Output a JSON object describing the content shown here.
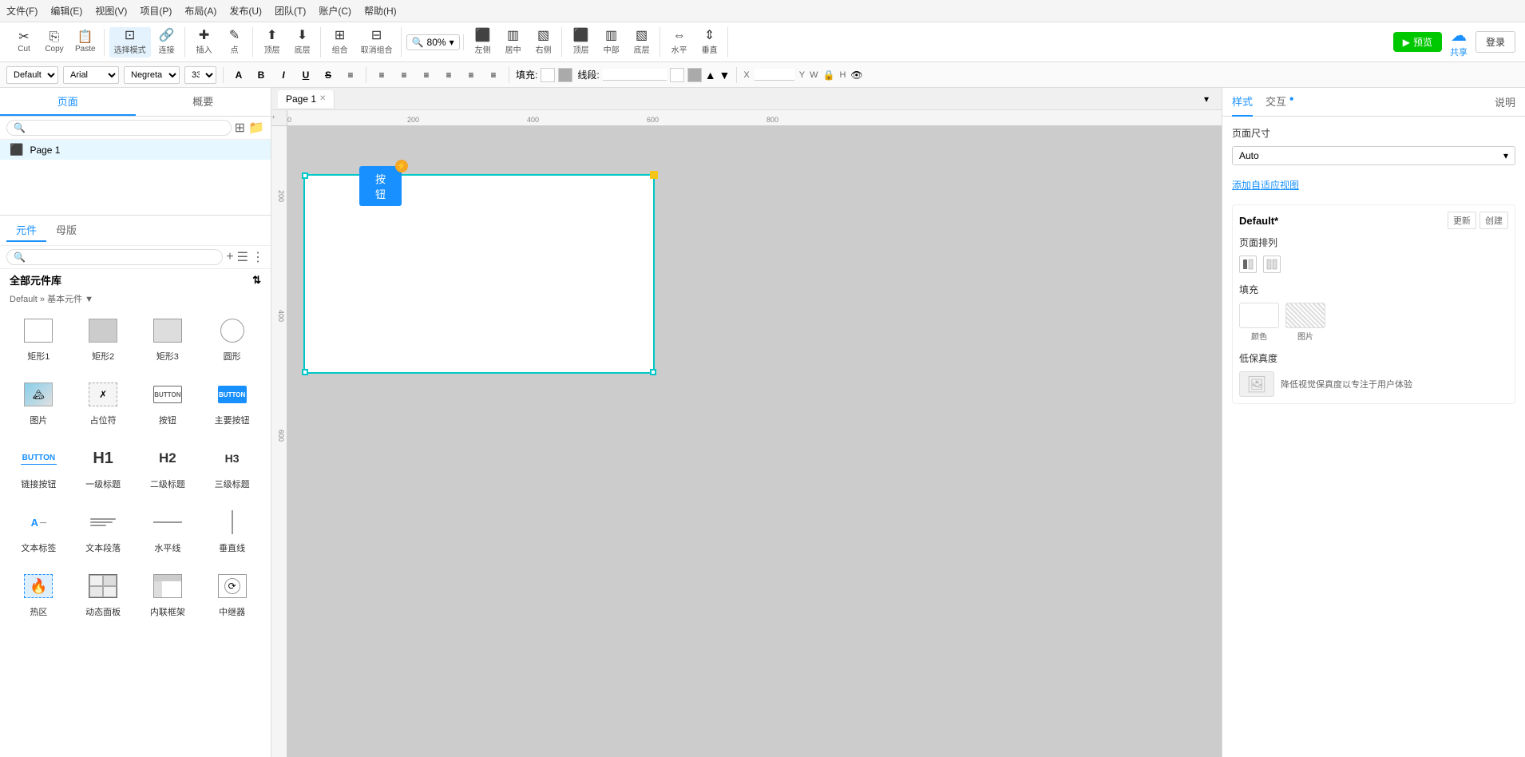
{
  "menubar": {
    "items": [
      {
        "label": "文件(F)"
      },
      {
        "label": "编辑(E)"
      },
      {
        "label": "视图(V)"
      },
      {
        "label": "项目(P)"
      },
      {
        "label": "布局(A)"
      },
      {
        "label": "发布(U)"
      },
      {
        "label": "团队(T)"
      },
      {
        "label": "账户(C)"
      },
      {
        "label": "帮助(H)"
      }
    ]
  },
  "toolbar": {
    "cut_label": "Cut",
    "copy_label": "Copy",
    "paste_label": "Paste",
    "select_mode_label": "选择模式",
    "connect_label": "连接",
    "insert_label": "插入",
    "point_label": "点",
    "top_label": "顶层",
    "bottom_label": "底层",
    "combine_label": "组合",
    "uncombine_label": "取消组合",
    "zoom_label": "80%",
    "left_align_label": "左侧",
    "center_align_label": "居中",
    "right_align_label": "右侧",
    "top_align_label": "顶层",
    "middle_align_label": "中部",
    "bottom_align_label": "底层",
    "horizontal_label": "水平",
    "vertical_label": "垂直",
    "preview_label": "预览",
    "share_label": "共享",
    "login_label": "登录"
  },
  "formatbar": {
    "style_label": "Default",
    "font_label": "Arial",
    "weight_label": "Negreta",
    "size_label": "33",
    "fill_label": "填充:",
    "stroke_label": "线段:",
    "x_label": "X",
    "y_label": "Y",
    "w_label": "W",
    "h_label": "H"
  },
  "left_panel": {
    "pages_tab": "页面",
    "overview_tab": "概要",
    "search_placeholder": "",
    "page1_label": "Page 1",
    "components_tab": "元件",
    "masters_tab": "母版",
    "all_components_title": "全部元件库",
    "breadcrumb": "Default » 基本元件 ▼",
    "components": [
      {
        "label": "矩形1",
        "type": "rect1"
      },
      {
        "label": "矩形2",
        "type": "rect2"
      },
      {
        "label": "矩形3",
        "type": "rect3"
      },
      {
        "label": "圆形",
        "type": "circle"
      },
      {
        "label": "图片",
        "type": "image"
      },
      {
        "label": "占位符",
        "type": "placeholder"
      },
      {
        "label": "按钮",
        "type": "button"
      },
      {
        "label": "主要按钮",
        "type": "main-button"
      },
      {
        "label": "链接按钮",
        "type": "link-button"
      },
      {
        "label": "一级标题",
        "type": "h1"
      },
      {
        "label": "二级标题",
        "type": "h2"
      },
      {
        "label": "三级标题",
        "type": "h3"
      },
      {
        "label": "文本标签",
        "type": "text-label"
      },
      {
        "label": "文本段落",
        "type": "text-para"
      },
      {
        "label": "水平线",
        "type": "hline"
      },
      {
        "label": "垂直线",
        "type": "vline"
      },
      {
        "label": "热区",
        "type": "hotzone"
      },
      {
        "label": "动态面板",
        "type": "dynamic"
      },
      {
        "label": "内联框架",
        "type": "inline"
      },
      {
        "label": "中继器",
        "type": "relay"
      }
    ]
  },
  "canvas": {
    "tab_label": "Page 1",
    "button_label": "按钮"
  },
  "right_panel": {
    "style_tab": "样式",
    "interact_tab": "交互",
    "explain_tab": "说明",
    "page_size_label": "页面尺寸",
    "auto_label": "Auto",
    "add_viewport_label": "添加自适应视图",
    "default_label": "Default*",
    "update_label": "更新",
    "create_label": "创建",
    "page_arrange_label": "页面排列",
    "fill_label": "填充",
    "color_label": "颜色",
    "image_label": "图片",
    "low_fidelity_label": "低保真度",
    "low_fidelity_desc": "降低视觉保真度以专注于用户体验"
  },
  "ruler": {
    "h_marks": [
      "0",
      "200",
      "400",
      "600",
      "800"
    ],
    "v_marks": [
      "200",
      "400",
      "600"
    ]
  }
}
